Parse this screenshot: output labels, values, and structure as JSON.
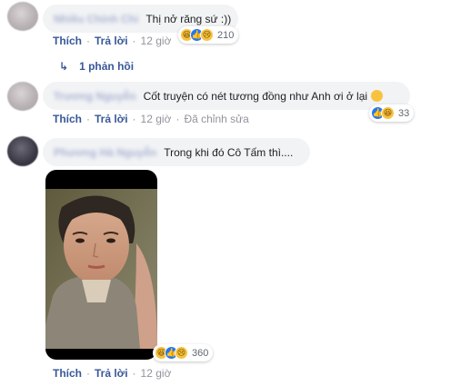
{
  "comments": [
    {
      "author": "Nhiều Chính Chi",
      "text": "Thị nở răng sứ :))",
      "actions": {
        "like": "Thích",
        "reply": "Trả lời",
        "time": "12 giờ"
      },
      "reactions": {
        "count": "210",
        "icons": [
          "haha-icon",
          "like-icon",
          "sad-icon"
        ]
      },
      "replies_label": "1 phản hồi"
    },
    {
      "author": "Trương Nguyễn",
      "text": "Cốt truyện có nét tương đồng như Anh ơi ở lại",
      "actions": {
        "like": "Thích",
        "reply": "Trả lời",
        "time": "12 giờ",
        "edited": "Đã chỉnh sửa"
      },
      "reactions": {
        "count": "33",
        "icons": [
          "like-icon",
          "haha-icon"
        ]
      }
    },
    {
      "author": "Phương Hà Nguyễn",
      "text": "Trong khi đó Cô Tấm thì....",
      "actions": {
        "like": "Thích",
        "reply": "Trả lời",
        "time": "12 giờ"
      },
      "reactions": {
        "count": "360",
        "icons": [
          "haha-icon",
          "like-icon",
          "sad-icon"
        ]
      }
    }
  ],
  "colors": {
    "link": "#385898",
    "bubble": "#f2f3f5",
    "like_blue": "#2078f4",
    "emoji_yellow": "#f7c33f"
  }
}
